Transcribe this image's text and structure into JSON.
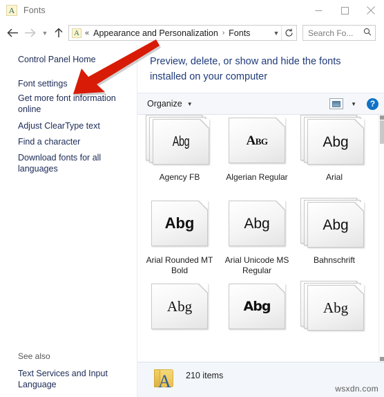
{
  "window": {
    "title": "Fonts",
    "icon": "fonts-letter-a-icon",
    "icon_letter": "A",
    "controls": {
      "minimize": "Minimize",
      "maximize": "Maximize",
      "close": "Close"
    }
  },
  "navbar": {
    "back": "Back",
    "forward": "Forward",
    "recent": "Recent locations",
    "up": "Up",
    "address_icon_letter": "A",
    "overflow": "«",
    "breadcrumbs": [
      "Appearance and Personalization",
      "Fonts"
    ],
    "separator": "›",
    "dropdown": "Previous locations",
    "refresh": "Refresh",
    "search": {
      "placeholder": "Search Fo...",
      "value": "",
      "icon": "search-icon"
    }
  },
  "sidebar": {
    "links": [
      {
        "label": "Control Panel Home"
      },
      {
        "label": "Font settings"
      },
      {
        "label": "Get more font information online"
      },
      {
        "label": "Adjust ClearType text"
      },
      {
        "label": "Find a character"
      },
      {
        "label": "Download fonts for all languages"
      }
    ],
    "see_also": {
      "heading": "See also",
      "links": [
        {
          "label": "Text Services and Input Language"
        }
      ]
    }
  },
  "main": {
    "heading": "Preview, delete, or show and hide the fonts installed on your computer",
    "toolbar": {
      "organize": "Organize",
      "organize_caret": "▼",
      "view_button": "change-view",
      "view_caret": "▼",
      "help": "?"
    },
    "fonts": [
      [
        {
          "name": "Agency FB",
          "sample": "Abg",
          "style": "agency",
          "stacked": true
        },
        {
          "name": "Algerian Regular",
          "sample": "Abg",
          "style": "algerian",
          "stacked": false
        },
        {
          "name": "Arial",
          "sample": "Abg",
          "style": "arial",
          "stacked": true
        }
      ],
      [
        {
          "name": "Arial Rounded MT Bold",
          "sample": "Abg",
          "style": "arialrnd",
          "stacked": false
        },
        {
          "name": "Arial Unicode MS Regular",
          "sample": "Abg",
          "style": "arialuni",
          "stacked": false
        },
        {
          "name": "Bahnschrift",
          "sample": "Abg",
          "style": "bahn",
          "stacked": true
        }
      ],
      [
        {
          "name": "",
          "sample": "Abg",
          "style": "serif1",
          "stacked": false
        },
        {
          "name": "",
          "sample": "Abg",
          "style": "bold2",
          "stacked": false
        },
        {
          "name": "",
          "sample": "Abg",
          "style": "serif2",
          "stacked": true
        }
      ]
    ],
    "scrollbar": {
      "position": "top"
    }
  },
  "statusbar": {
    "folder_icon": "fonts-folder-icon",
    "folder_letter": "A",
    "item_count": "210 items"
  },
  "watermark": {
    "text": "wsxdn.com"
  },
  "annotation": {
    "arrow_color": "#d81b06",
    "target": "Font settings"
  },
  "colors": {
    "link": "#1b2a57",
    "heading": "#1f3a7a",
    "toolbar_bg": "#f5f7fa",
    "status_bg": "#f3f6fa",
    "help_blue": "#1072c6",
    "annotation_red": "#d81b06"
  }
}
